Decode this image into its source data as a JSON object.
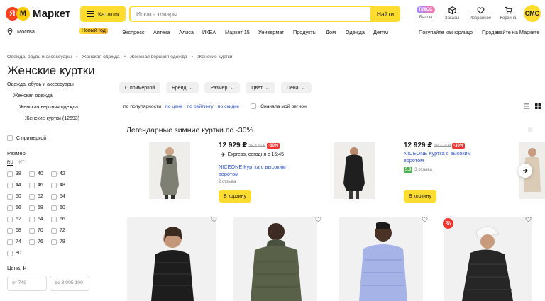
{
  "header": {
    "logo_text": "Маркет",
    "catalog_label": "Каталог",
    "search_placeholder": "Искать товары",
    "search_button": "Найти",
    "plus_badge": "ПЛЮС",
    "icons": [
      {
        "label": "Баллы",
        "icon": "plus-points-icon"
      },
      {
        "label": "Заказы",
        "icon": "box-icon"
      },
      {
        "label": "Избранное",
        "icon": "heart-icon"
      },
      {
        "label": "Корзина",
        "icon": "cart-icon"
      }
    ],
    "avatar_text": "СМС",
    "accent_color": "#ffdc2f"
  },
  "nav": {
    "location": "Москва",
    "new_year": "Новый год",
    "links": [
      "Экспресс",
      "Аптека",
      "Алиса",
      "ИКЕА",
      "Маркет 15",
      "Универмаг",
      "Продукты",
      "Дом",
      "Одежда",
      "Детям"
    ],
    "right_links": [
      "Покупайте как юрлицо",
      "Продавайте на Маркете"
    ]
  },
  "breadcrumbs": [
    "Одежда, обувь и аксессуары",
    "Женская одежда",
    "Женская верхняя одежда",
    "Женские куртки"
  ],
  "page_title": "Женские куртки",
  "sidebar": {
    "tree": [
      "Одежда, обувь и аксессуары",
      "Женская одежда",
      "Женская верхняя одежда",
      "Женские куртки (12593)"
    ],
    "try_on": "С примеркой",
    "size_title": "Размер",
    "size_tabs": [
      "RU",
      "INT"
    ],
    "sizes": [
      "38",
      "40",
      "42",
      "44",
      "46",
      "48",
      "50",
      "52",
      "54",
      "56",
      "58",
      "60",
      "62",
      "64",
      "66",
      "68",
      "70",
      "72",
      "74",
      "76",
      "78",
      "80"
    ],
    "price_title": "Цена, ₽",
    "price_from": "от 749",
    "price_to": "до 3 005 100"
  },
  "filters": {
    "chips": [
      "С примеркой",
      "Бренд",
      "Размер",
      "Цвет",
      "Цена"
    ],
    "sort_label": "по популярности",
    "sort_links": [
      "по цене",
      "по рейтингу",
      "по скидке"
    ],
    "region_label": "Сначала мой регион"
  },
  "promo": {
    "title": "Легендарные зимние куртки по -30%",
    "products": [
      {
        "price": "12 929 ₽",
        "old_price": "18 470 ₽",
        "discount": "-30%",
        "delivery": "Express, сегодня с 16:45",
        "name": "NICEONE Куртка с высоким воротом",
        "reviews": "2 отзыва",
        "button": "В корзину"
      },
      {
        "price": "12 929 ₽",
        "old_price": "18 470 ₽",
        "discount": "-30%",
        "name": "NICEONE Куртка с высоким воротом",
        "rating": "5.0",
        "reviews": "3 отзыва",
        "button": "В корзину"
      }
    ]
  },
  "sale_badge": "%"
}
